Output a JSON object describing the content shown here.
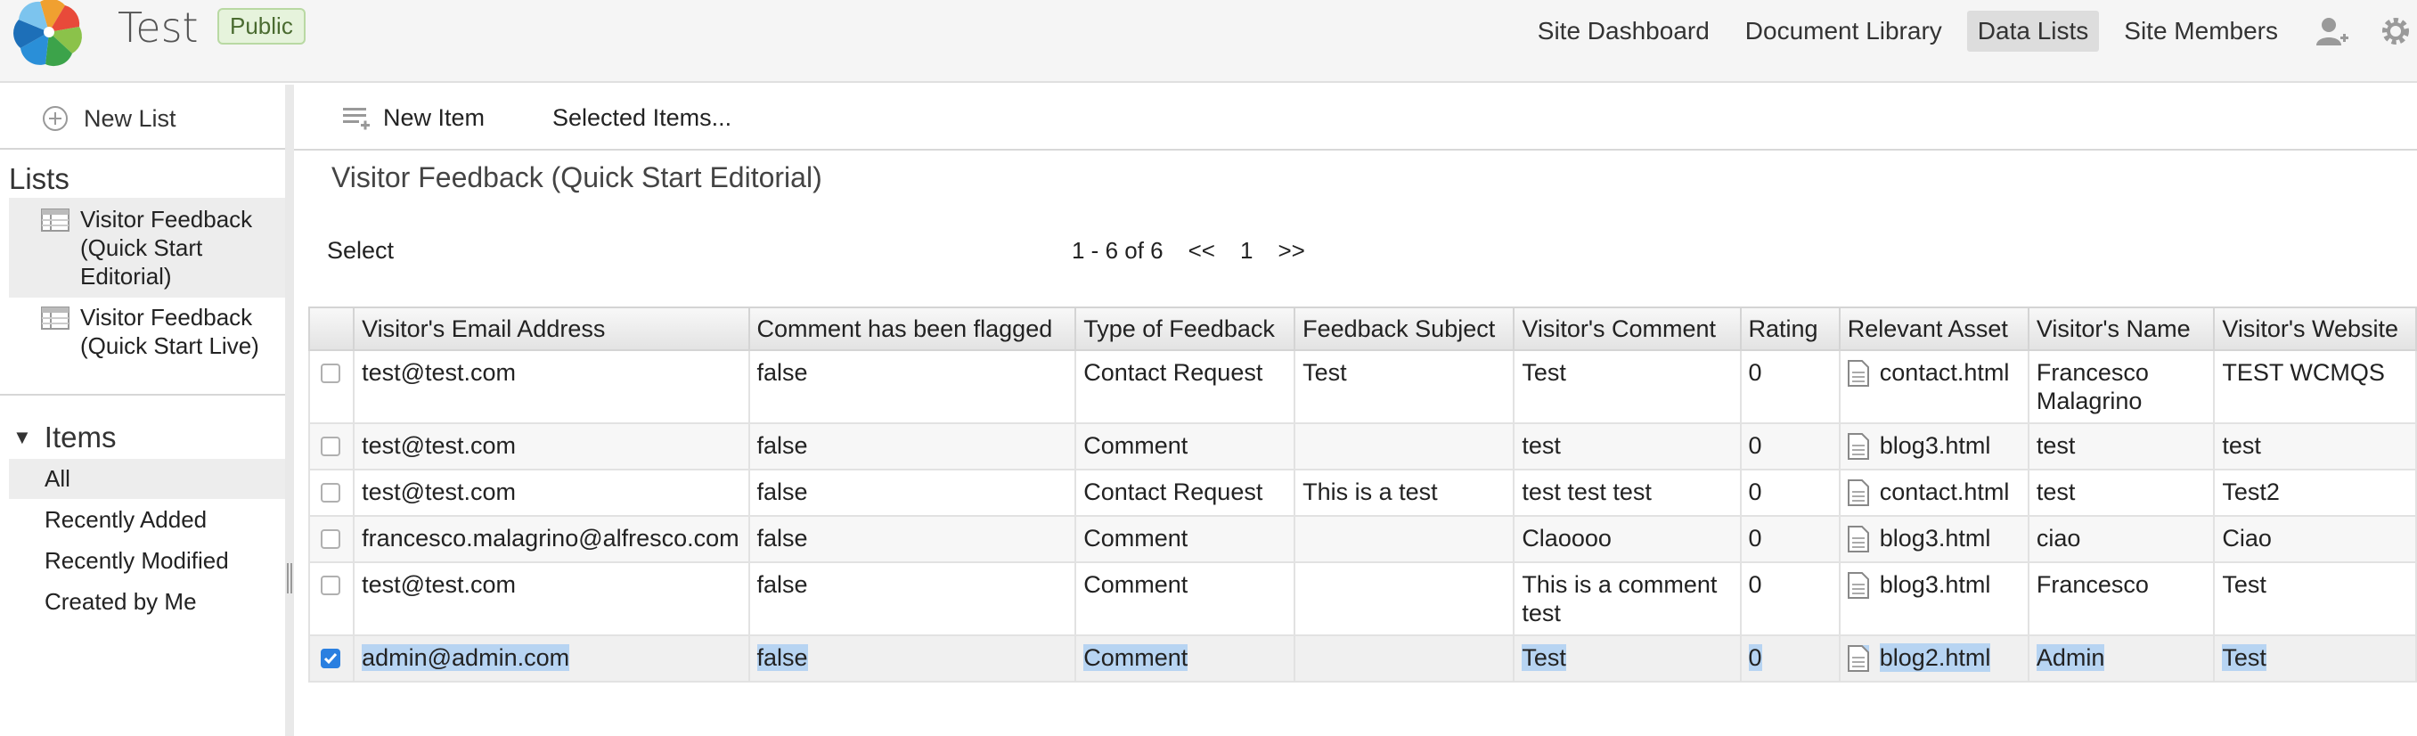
{
  "header": {
    "site_title": "Test",
    "visibility_badge": "Public",
    "nav": [
      {
        "label": "Site Dashboard",
        "active": false
      },
      {
        "label": "Document Library",
        "active": false
      },
      {
        "label": "Data Lists",
        "active": true
      },
      {
        "label": "Site Members",
        "active": false
      }
    ],
    "icons": [
      "add-user-icon",
      "gear-icon"
    ]
  },
  "left_panel": {
    "new_list_label": "New List",
    "lists_title": "Lists",
    "lists": [
      {
        "label": "Visitor Feedback (Quick Start Editorial)",
        "selected": true
      },
      {
        "label": "Visitor Feedback (Quick Start Live)",
        "selected": false
      }
    ],
    "items_title": "Items",
    "filters": [
      {
        "label": "All",
        "selected": true
      },
      {
        "label": "Recently Added",
        "selected": false
      },
      {
        "label": "Recently Modified",
        "selected": false
      },
      {
        "label": "Created by Me",
        "selected": false
      }
    ]
  },
  "toolbar": {
    "new_item_label": "New Item",
    "selected_items_label": "Selected Items..."
  },
  "main": {
    "list_title": "Visitor Feedback (Quick Start Editorial)",
    "select_label": "Select",
    "paginator": {
      "range": "1 - 6 of 6",
      "prev": "<<",
      "page": "1",
      "next": ">>"
    }
  },
  "table": {
    "columns": [
      "Visitor's Email Address",
      "Comment has been flagged",
      "Type of Feedback",
      "Feedback Subject",
      "Visitor's Comment",
      "Rating",
      "Relevant Asset",
      "Visitor's Name",
      "Visitor's Website"
    ],
    "rows": [
      {
        "email": "test@test.com",
        "flagged": "false",
        "type": "Contact Request",
        "subject": "Test",
        "comment": "Test",
        "rating": "0",
        "asset": "contact.html",
        "name": "Francesco Malagrino",
        "website": "TEST WCMQS",
        "checked": false
      },
      {
        "email": "test@test.com",
        "flagged": "false",
        "type": "Comment",
        "subject": "",
        "comment": "test",
        "rating": "0",
        "asset": "blog3.html",
        "name": "test",
        "website": "test",
        "checked": false
      },
      {
        "email": "test@test.com",
        "flagged": "false",
        "type": "Contact Request",
        "subject": "This is a test",
        "comment": "test test test",
        "rating": "0",
        "asset": "contact.html",
        "name": "test",
        "website": "Test2",
        "checked": false
      },
      {
        "email": "francesco.malagrino@alfresco.com",
        "flagged": "false",
        "type": "Comment",
        "subject": "",
        "comment": "Claoooo",
        "rating": "0",
        "asset": "blog3.html",
        "name": "ciao",
        "website": "Ciao",
        "checked": false
      },
      {
        "email": "test@test.com",
        "flagged": "false",
        "type": "Comment",
        "subject": "",
        "comment": "This is a comment test",
        "rating": "0",
        "asset": "blog3.html",
        "name": "Francesco",
        "website": "Test",
        "checked": false
      },
      {
        "email": "admin@admin.com",
        "flagged": "false",
        "type": "Comment",
        "subject": "",
        "comment": "Test",
        "rating": "0",
        "asset": "blog2.html",
        "name": "Admin",
        "website": "Test",
        "checked": true
      }
    ]
  },
  "colors": {
    "selection_highlight": "#b7d4f2",
    "checkbox_checked": "#2a7fe0",
    "badge_bg": "#e6f3dc"
  }
}
